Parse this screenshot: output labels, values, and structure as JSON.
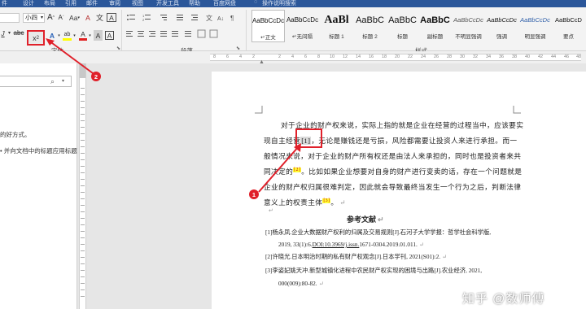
{
  "titlebar": {
    "tabs": [
      "件",
      "设计",
      "布局",
      "引用",
      "邮件",
      "审阅",
      "视图",
      "开发工具",
      "帮助",
      "百度网盘"
    ],
    "tell_me": "操作说明搜索"
  },
  "font_group": {
    "label": "字体",
    "font_size": "小四",
    "grow": "A",
    "shrink": "A",
    "change_case": "Aa",
    "clear_format": "A",
    "wen": "文",
    "frame_a": "A",
    "subscript_x": "x",
    "superscript_x": "x",
    "superscript_power": "2",
    "text_effects": "A",
    "highlight": "ab",
    "font_color": "A",
    "char_shade": "A",
    "char_border": "A"
  },
  "para_group": {
    "label": "段落"
  },
  "styles_group": {
    "label": "样式",
    "items": [
      {
        "preview": "AaBbCcDc",
        "name": "正文"
      },
      {
        "preview": "AaBbCcDc",
        "name": "无间隔"
      },
      {
        "preview": "AaBl",
        "name": "标题 1"
      },
      {
        "preview": "AaBbC",
        "name": "标题 2"
      },
      {
        "preview": "AaBbC",
        "name": "标题"
      },
      {
        "preview": "AaBbC",
        "name": "副标题"
      },
      {
        "preview": "AaBbCcDc",
        "name": "不明显强调"
      },
      {
        "preview": "AaBbCcDc",
        "name": "强调"
      },
      {
        "preview": "AaBbCcDc",
        "name": "明显强调"
      },
      {
        "preview": "AaBbCcD",
        "name": "要点"
      }
    ]
  },
  "ruler": {
    "marks": [
      "8",
      "6",
      "4",
      "2",
      "2",
      "4",
      "6",
      "8",
      "10",
      "12",
      "14",
      "16",
      "18",
      "20",
      "22",
      "24",
      "26",
      "28",
      "30",
      "32",
      "34",
      "36",
      "38",
      "40",
      "42",
      "44",
      "46",
      "48"
    ]
  },
  "nav_pane": {
    "search_icon": "magnifier",
    "line1": "的好方式。",
    "line2": "并向文档中的标题应用标题"
  },
  "document": {
    "paragraph": {
      "line1": "对于企业的财产权来说，实际上指的就是企业在经营的过程当中，应该要实",
      "line2_pre": "现自主经营",
      "line2_mark": "[1]",
      "line2_post": "，无论是赚钱还是亏损，风险都需要让投资人来进行承担。而一",
      "line3": "般情况来说，对于企业的财产所有权还是由法人来承担的，同时也是投资者来共",
      "line4_pre": "同决定的",
      "line4_mark": "[2]",
      "line4_post": "。比如如果企业想要对自身的财产进行变卖的话，存在一个问题就是",
      "line5": "企业的财产权归属很难判定，因此就会导致最终当发生一个行为之后，判断法律",
      "line6_pre": "意义上的权责主体",
      "line6_mark": "[3]",
      "line6_post": "。"
    },
    "ref_title": "参考文献",
    "refs": [
      {
        "l1": "[1]杨永凤.企业大数据财产权利的归属及交易规则[J].石河子大学学报：哲学社会科学版,",
        "l2a": "2019, 33(1):6.",
        "l2b": "DOI:10.3969/j.issn.",
        "l2c": "1671-0304.2019.01.011."
      },
      {
        "l1": "[2]许晓光.日本明治时期的私有财产权观念[J].日本学刊, 2021(S01):2."
      },
      {
        "l1": "[3]李姿妃姚天冲.新型城镇化进程中农民财产权实现的困境与出路[J].农业经济, 2021,",
        "l2a": "000(009):80-82."
      }
    ]
  },
  "annotations": {
    "badge1": "1",
    "badge2": "2"
  },
  "watermark": "知乎 @数师傅",
  "colors": {
    "accent": "#2b579a",
    "callout": "#e0202a",
    "highlight": "#ffff33"
  }
}
